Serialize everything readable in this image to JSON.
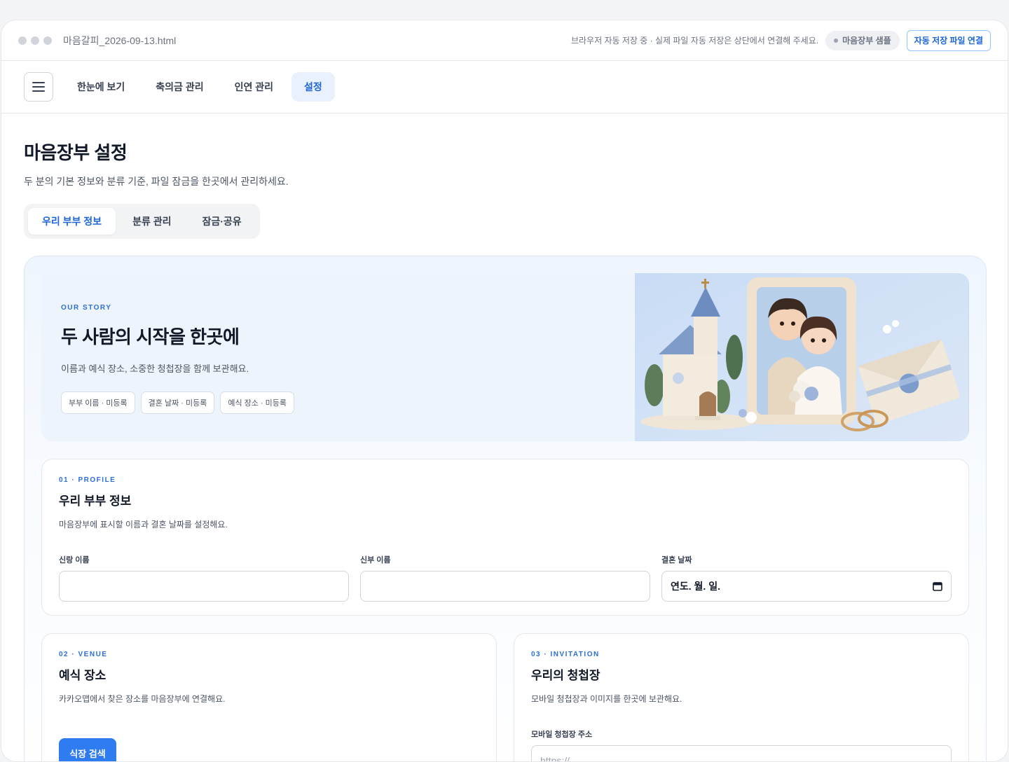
{
  "titlebar": {
    "filename": "마음갈피_2026-09-13.html",
    "autosave_note": "브라우저 자동 저장 중 · 실제 파일 자동 저장은 상단에서 연결해 주세요.",
    "sample_badge": "마음장부 샘플",
    "connect_button": "자동 저장 파일 연결"
  },
  "nav": {
    "tabs": [
      {
        "label": "한눈에 보기"
      },
      {
        "label": "축의금 관리"
      },
      {
        "label": "인연 관리"
      },
      {
        "label": "설정"
      }
    ],
    "active": "설정"
  },
  "page": {
    "title": "마음장부 설정",
    "description": "두 분의 기본 정보와 분류 기준, 파일 잠금을 한곳에서 관리하세요."
  },
  "subtabs": [
    {
      "label": "우리 부부 정보"
    },
    {
      "label": "분류 관리"
    },
    {
      "label": "잠금·공유"
    }
  ],
  "hero": {
    "eyebrow": "OUR STORY",
    "title": "두 사람의 시작을 한곳에",
    "description": "이름과 예식 장소, 소중한 청첩장을 함께 보관해요.",
    "chips": [
      {
        "label": "부부 이름 · 미등록"
      },
      {
        "label": "결혼 날짜 · 미등록"
      },
      {
        "label": "예식 장소 · 미등록"
      }
    ]
  },
  "profile": {
    "eyebrow": "01 · PROFILE",
    "title": "우리 부부 정보",
    "description": "마음장부에 표시할 이름과 결혼 날짜를 설정해요.",
    "fields": [
      {
        "label": "신랑 이름",
        "value": ""
      },
      {
        "label": "신부 이름",
        "value": ""
      },
      {
        "label": "결혼 날짜",
        "value": "연도. 월. 일."
      }
    ]
  },
  "venue": {
    "eyebrow": "02 · VENUE",
    "title": "예식 장소",
    "description": "카카오맵에서 찾은 장소를 마음장부에 연결해요.",
    "search_button": "식장 검색"
  },
  "invitation": {
    "eyebrow": "03 · INVITATION",
    "title": "우리의 청첩장",
    "description": "모바일 청첩장과 이미지를 한곳에 보관해요.",
    "url_label": "모바일 청첩장 주소",
    "url_placeholder": "https://"
  }
}
